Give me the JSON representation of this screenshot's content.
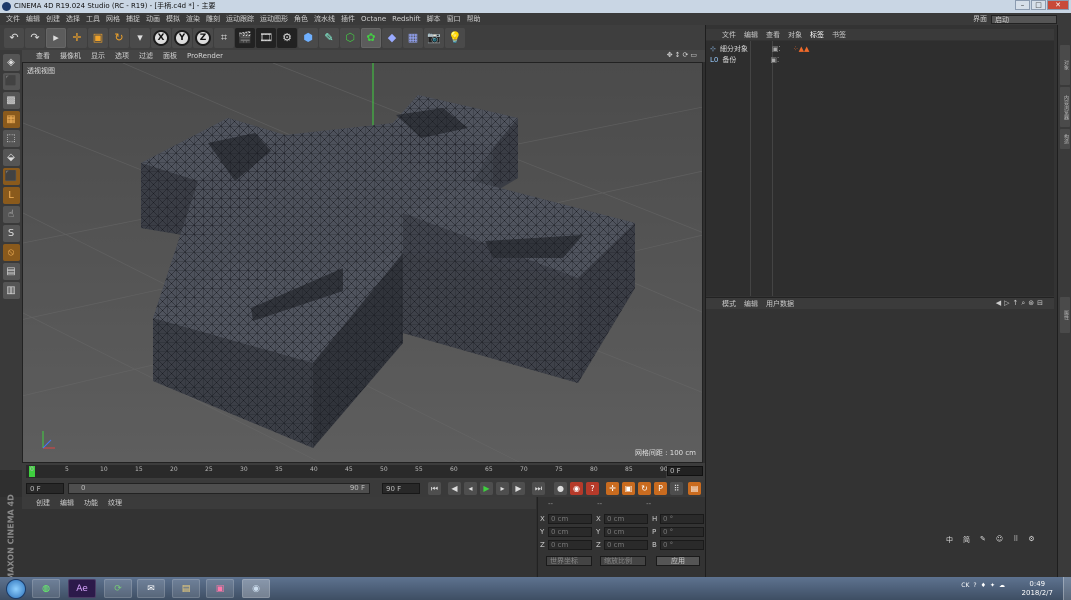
{
  "window": {
    "title": "CINEMA 4D R19.024 Studio (RC - R19) - [手柄.c4d *] - 主要"
  },
  "menu": [
    "文件",
    "编辑",
    "创建",
    "选择",
    "工具",
    "网格",
    "捕捉",
    "动画",
    "模拟",
    "渲染",
    "雕刻",
    "运动跟踪",
    "运动图形",
    "角色",
    "流水线",
    "插件",
    "Octane",
    "Redshift",
    "脚本",
    "窗口",
    "帮助"
  ],
  "layout": {
    "label": "界面",
    "value": "启动"
  },
  "viewport": {
    "menu": [
      "查看",
      "摄像机",
      "显示",
      "选项",
      "过滤",
      "面板",
      "ProRender"
    ],
    "label": "透视视图",
    "grid_label": "网格间距 : 100 cm"
  },
  "timeline": {
    "ticks": [
      "0",
      "5",
      "10",
      "15",
      "20",
      "25",
      "30",
      "35",
      "40",
      "45",
      "50",
      "55",
      "60",
      "65",
      "70",
      "75",
      "80",
      "85",
      "90"
    ],
    "frame": "0 F"
  },
  "playback": {
    "start": "0 F",
    "min": "0",
    "max": "90 F",
    "end": "90 F"
  },
  "materials": {
    "menu": [
      "创建",
      "编辑",
      "功能",
      "纹理"
    ],
    "brand1": "MAXON",
    "brand2": "CINEMA 4D"
  },
  "coords": {
    "headers": [
      "--",
      "--",
      "--"
    ],
    "rows": [
      {
        "l1": "X",
        "v1": "0 cm",
        "l2": "X",
        "v2": "0 cm",
        "l3": "H",
        "v3": "0 °"
      },
      {
        "l1": "Y",
        "v1": "0 cm",
        "l2": "Y",
        "v2": "0 cm",
        "l3": "P",
        "v3": "0 °"
      },
      {
        "l1": "Z",
        "v1": "0 cm",
        "l2": "Z",
        "v2": "0 cm",
        "l3": "B",
        "v3": "0 °"
      }
    ],
    "mode1": "世界坐标",
    "mode2": "缩放比例",
    "apply": "应用"
  },
  "objects": {
    "tabs": [
      "文件",
      "编辑",
      "查看",
      "对象",
      "标签",
      "书签"
    ],
    "items": [
      {
        "name": "細分对象"
      },
      {
        "name": "备份"
      }
    ]
  },
  "attributes": {
    "tabs": [
      "模式",
      "编辑",
      "用户数据"
    ],
    "footer": [
      "中",
      "简",
      "✎",
      "☺",
      "⠿",
      "⚙"
    ]
  },
  "taskbar": {
    "apps": [
      "",
      "Ae",
      "",
      "",
      "",
      "",
      ""
    ],
    "tray": [
      "CK",
      "?",
      "♦",
      "✦",
      "☁"
    ],
    "time": "0:49",
    "date": "2018/2/7"
  },
  "colors": {
    "accent": "#c96b1f",
    "viewport": "#5b5b5b",
    "panel": "#333333"
  }
}
